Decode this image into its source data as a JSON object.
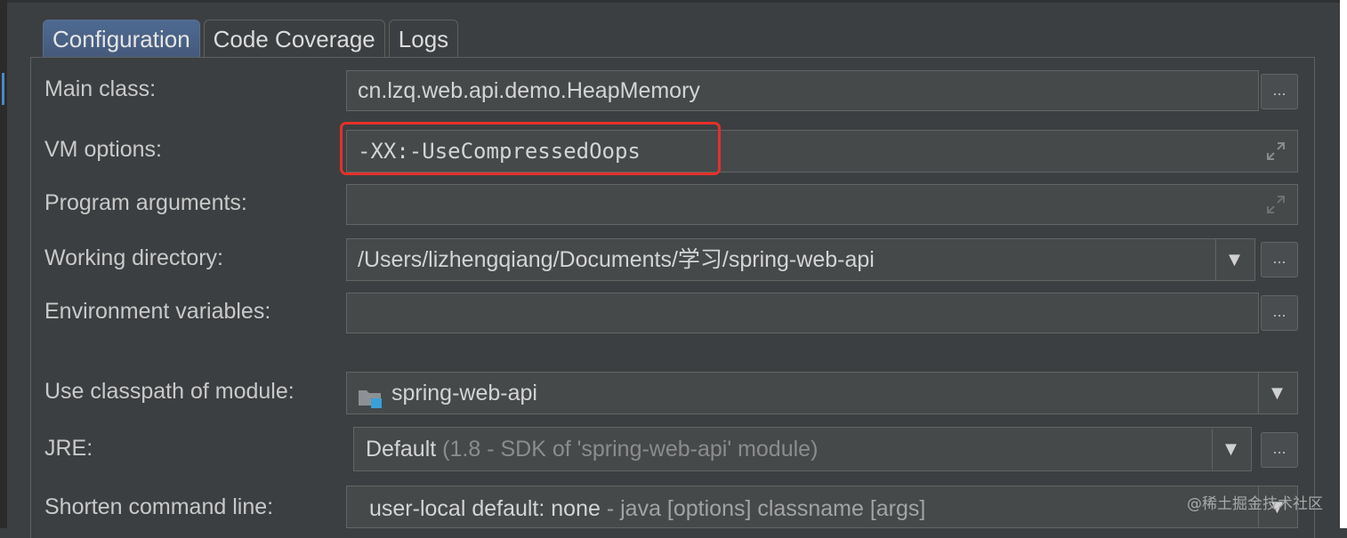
{
  "tabs": [
    {
      "label": "Configuration",
      "active": true
    },
    {
      "label": "Code Coverage",
      "active": false
    },
    {
      "label": "Logs",
      "active": false
    }
  ],
  "form": {
    "main_class": {
      "label": "Main class:",
      "value": "cn.lzq.web.api.demo.HeapMemory"
    },
    "vm_options": {
      "label": "VM options:",
      "value": "-XX:-UseCompressedOops"
    },
    "program_arguments": {
      "label": "Program arguments:",
      "value": ""
    },
    "working_directory": {
      "label": "Working directory:",
      "value": "/Users/lizhengqiang/Documents/学习/spring-web-api"
    },
    "environment_variables": {
      "label": "Environment variables:",
      "value": ""
    },
    "classpath_module": {
      "label": "Use classpath of module:",
      "value": "spring-web-api"
    },
    "jre": {
      "label": "JRE:",
      "value": "Default",
      "detail": "(1.8 - SDK of 'spring-web-api' module)"
    },
    "shorten_command_line": {
      "label": "Shorten command line:",
      "value": "user-local default: none",
      "detail": "- java [options] classname [args]"
    }
  },
  "browse_label": "...",
  "watermark": "@稀土掘金技术社区",
  "colors": {
    "highlight": "#e5302a",
    "active_tab": "#4b6eaf",
    "background": "#3c3f41"
  }
}
